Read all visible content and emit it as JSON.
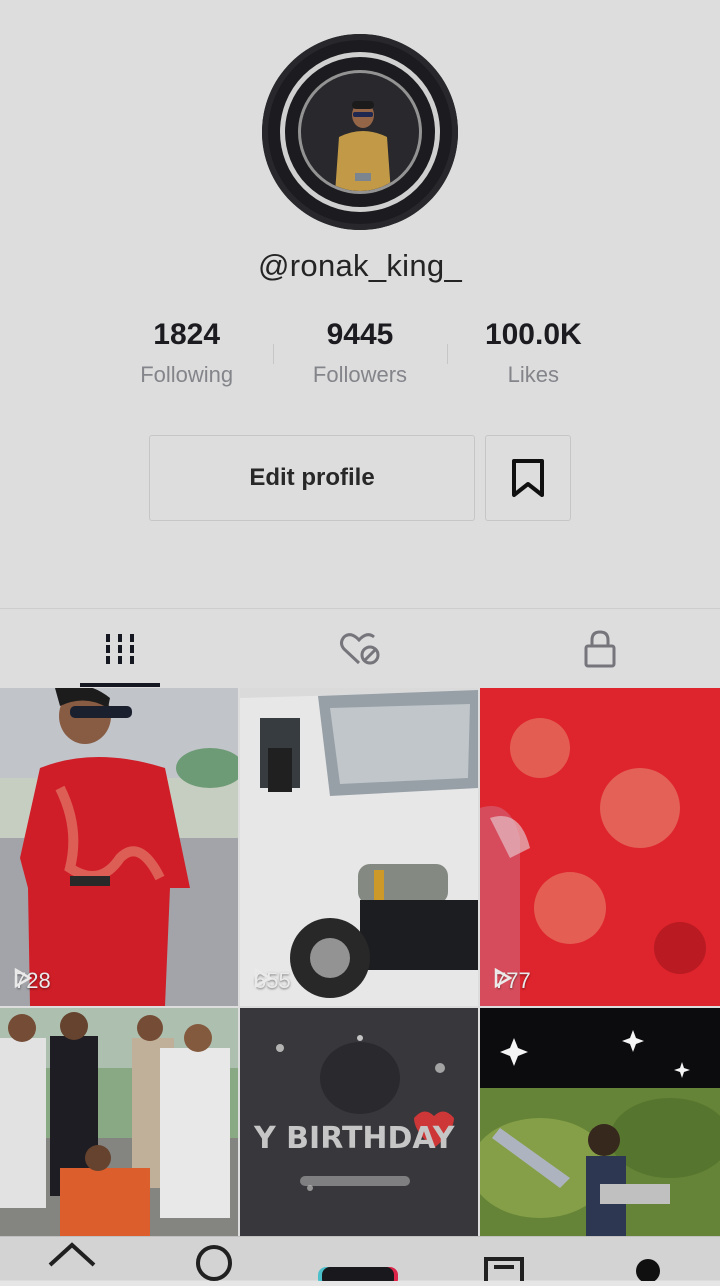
{
  "profile": {
    "username": "@ronak_king_",
    "stats": [
      {
        "value": "1824",
        "label": "Following"
      },
      {
        "value": "9445",
        "label": "Followers"
      },
      {
        "value": "100.0K",
        "label": "Likes"
      }
    ],
    "edit_profile_label": "Edit profile"
  },
  "tabs": [
    {
      "icon": "grid-videos-icon",
      "active": true
    },
    {
      "icon": "liked-private-icon",
      "active": false
    },
    {
      "icon": "lock-icon",
      "active": false
    }
  ],
  "videos": [
    {
      "views": "728"
    },
    {
      "views": "655"
    },
    {
      "views": "777"
    },
    {
      "views": ""
    },
    {
      "views": "",
      "overlay_text": "Y BIRTHDAY"
    },
    {
      "views": ""
    }
  ],
  "bottom_nav": [
    "home-icon",
    "discover-icon",
    "create-icon",
    "inbox-icon",
    "profile-icon"
  ],
  "colors": {
    "accent_red": "#e8262e",
    "text": "#161823",
    "muted": "#8a8b91"
  }
}
